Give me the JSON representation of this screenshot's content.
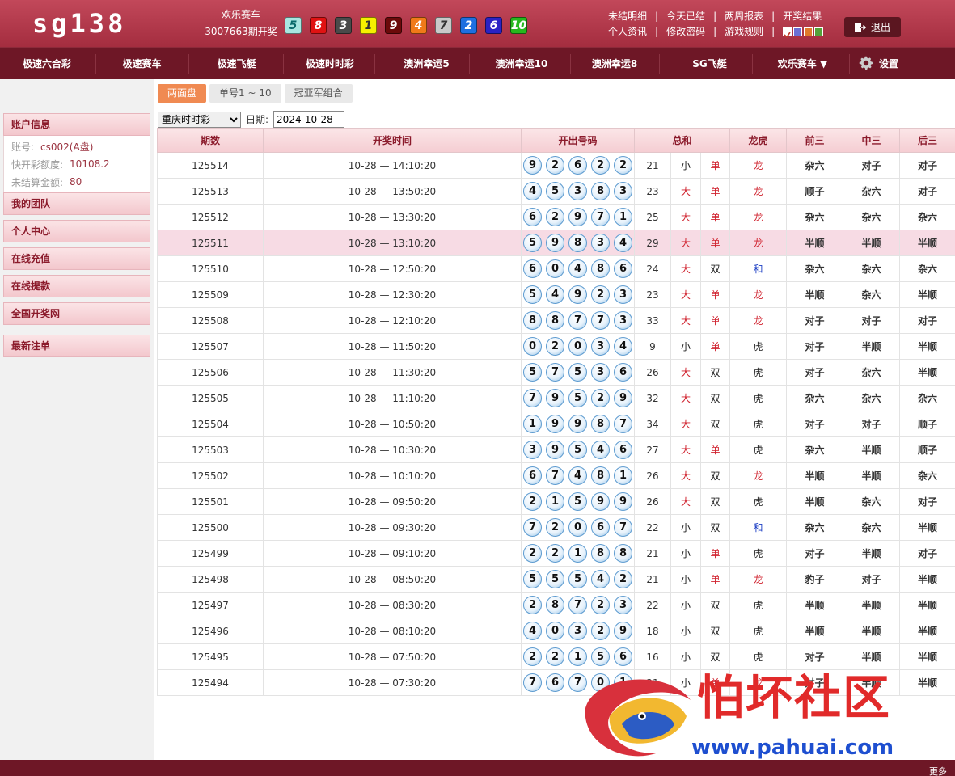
{
  "brand": {
    "logo": "sg138"
  },
  "draw_info": {
    "game": "欢乐赛车",
    "period": "3007663期开奖"
  },
  "header_balls": [
    {
      "n": "5",
      "color": "#a8e6e0",
      "fg": "#0a6b6b"
    },
    {
      "n": "8",
      "color": "#e01212",
      "fg": "#ffffff"
    },
    {
      "n": "3",
      "color": "#4a4a4a",
      "fg": "#ffffff"
    },
    {
      "n": "1",
      "color": "#f5f000",
      "fg": "#333333"
    },
    {
      "n": "9",
      "color": "#6b0a0a",
      "fg": "#ffffff"
    },
    {
      "n": "4",
      "color": "#f07a18",
      "fg": "#ffffff"
    },
    {
      "n": "7",
      "color": "#c9c9c9",
      "fg": "#333333"
    },
    {
      "n": "2",
      "color": "#1e6fe0",
      "fg": "#ffffff"
    },
    {
      "n": "6",
      "color": "#2a22c4",
      "fg": "#ffffff"
    },
    {
      "n": "10",
      "color": "#27b81d",
      "fg": "#ffffff"
    }
  ],
  "header_links": {
    "row1": [
      "未结明细",
      "今天已结",
      "两周报表",
      "开奖结果"
    ],
    "row2": [
      "个人资讯",
      "修改密码",
      "游戏规则"
    ],
    "theme_colors": [
      "#c0392b",
      "#6b6fd4",
      "#e07a2b",
      "#54a33a"
    ]
  },
  "logout": "退出",
  "nav": [
    "极速六合彩",
    "极速赛车",
    "极速飞艇",
    "极速时时彩",
    "澳洲幸运5",
    "澳洲幸运10",
    "澳洲幸运8",
    "SG飞艇",
    "欢乐赛车 ▼"
  ],
  "nav_settings": "设置",
  "sidebar": {
    "account_title": "账户信息",
    "account_label": "账号:",
    "account_value": "cs002(A盘)",
    "credit_label": "快开彩额度:",
    "credit_value": "10108.2",
    "unsettled_label": "未结算金额:",
    "unsettled_value": "80",
    "menu": [
      "我的团队",
      "个人中心",
      "在线充值",
      "在线提款",
      "全国开奖网",
      "最新注单"
    ]
  },
  "tabs": [
    "两面盘",
    "单号1 ~ 10",
    "冠亚军组合"
  ],
  "filter": {
    "lottery": "重庆时时彩",
    "date_label": "日期:",
    "date": "2024-10-28"
  },
  "columns": [
    "期数",
    "开奖时间",
    "开出号码",
    "总和",
    "龙虎",
    "前三",
    "中三",
    "后三"
  ],
  "rows": [
    {
      "id": "125514",
      "time": "10-28 — 14:10:20",
      "balls": [
        "9",
        "2",
        "6",
        "2",
        "2"
      ],
      "sum": "21",
      "size": "小",
      "odd": "单",
      "lh": "龙",
      "q": "杂六",
      "z": "对子",
      "h": "对子"
    },
    {
      "id": "125513",
      "time": "10-28 — 13:50:20",
      "balls": [
        "4",
        "5",
        "3",
        "8",
        "3"
      ],
      "sum": "23",
      "size": "大",
      "odd": "单",
      "lh": "龙",
      "q": "顺子",
      "z": "杂六",
      "h": "对子"
    },
    {
      "id": "125512",
      "time": "10-28 — 13:30:20",
      "balls": [
        "6",
        "2",
        "9",
        "7",
        "1"
      ],
      "sum": "25",
      "size": "大",
      "odd": "单",
      "lh": "龙",
      "q": "杂六",
      "z": "杂六",
      "h": "杂六"
    },
    {
      "id": "125511",
      "time": "10-28 — 13:10:20",
      "balls": [
        "5",
        "9",
        "8",
        "3",
        "4"
      ],
      "sum": "29",
      "size": "大",
      "odd": "单",
      "lh": "龙",
      "q": "半顺",
      "z": "半顺",
      "h": "半顺",
      "highlight": true
    },
    {
      "id": "125510",
      "time": "10-28 — 12:50:20",
      "balls": [
        "6",
        "0",
        "4",
        "8",
        "6"
      ],
      "sum": "24",
      "size": "大",
      "odd": "双",
      "lh": "和",
      "q": "杂六",
      "z": "杂六",
      "h": "杂六"
    },
    {
      "id": "125509",
      "time": "10-28 — 12:30:20",
      "balls": [
        "5",
        "4",
        "9",
        "2",
        "3"
      ],
      "sum": "23",
      "size": "大",
      "odd": "单",
      "lh": "龙",
      "q": "半顺",
      "z": "杂六",
      "h": "半顺"
    },
    {
      "id": "125508",
      "time": "10-28 — 12:10:20",
      "balls": [
        "8",
        "8",
        "7",
        "7",
        "3"
      ],
      "sum": "33",
      "size": "大",
      "odd": "单",
      "lh": "龙",
      "q": "对子",
      "z": "对子",
      "h": "对子"
    },
    {
      "id": "125507",
      "time": "10-28 — 11:50:20",
      "balls": [
        "0",
        "2",
        "0",
        "3",
        "4"
      ],
      "sum": "9",
      "size": "小",
      "odd": "单",
      "lh": "虎",
      "q": "对子",
      "z": "半顺",
      "h": "半顺"
    },
    {
      "id": "125506",
      "time": "10-28 — 11:30:20",
      "balls": [
        "5",
        "7",
        "5",
        "3",
        "6"
      ],
      "sum": "26",
      "size": "大",
      "odd": "双",
      "lh": "虎",
      "q": "对子",
      "z": "杂六",
      "h": "半顺"
    },
    {
      "id": "125505",
      "time": "10-28 — 11:10:20",
      "balls": [
        "7",
        "9",
        "5",
        "2",
        "9"
      ],
      "sum": "32",
      "size": "大",
      "odd": "双",
      "lh": "虎",
      "q": "杂六",
      "z": "杂六",
      "h": "杂六"
    },
    {
      "id": "125504",
      "time": "10-28 — 10:50:20",
      "balls": [
        "1",
        "9",
        "9",
        "8",
        "7"
      ],
      "sum": "34",
      "size": "大",
      "odd": "双",
      "lh": "虎",
      "q": "对子",
      "z": "对子",
      "h": "顺子"
    },
    {
      "id": "125503",
      "time": "10-28 — 10:30:20",
      "balls": [
        "3",
        "9",
        "5",
        "4",
        "6"
      ],
      "sum": "27",
      "size": "大",
      "odd": "单",
      "lh": "虎",
      "q": "杂六",
      "z": "半顺",
      "h": "顺子"
    },
    {
      "id": "125502",
      "time": "10-28 — 10:10:20",
      "balls": [
        "6",
        "7",
        "4",
        "8",
        "1"
      ],
      "sum": "26",
      "size": "大",
      "odd": "双",
      "lh": "龙",
      "q": "半顺",
      "z": "半顺",
      "h": "杂六"
    },
    {
      "id": "125501",
      "time": "10-28 — 09:50:20",
      "balls": [
        "2",
        "1",
        "5",
        "9",
        "9"
      ],
      "sum": "26",
      "size": "大",
      "odd": "双",
      "lh": "虎",
      "q": "半顺",
      "z": "杂六",
      "h": "对子"
    },
    {
      "id": "125500",
      "time": "10-28 — 09:30:20",
      "balls": [
        "7",
        "2",
        "0",
        "6",
        "7"
      ],
      "sum": "22",
      "size": "小",
      "odd": "双",
      "lh": "和",
      "q": "杂六",
      "z": "杂六",
      "h": "半顺"
    },
    {
      "id": "125499",
      "time": "10-28 — 09:10:20",
      "balls": [
        "2",
        "2",
        "1",
        "8",
        "8"
      ],
      "sum": "21",
      "size": "小",
      "odd": "单",
      "lh": "虎",
      "q": "对子",
      "z": "半顺",
      "h": "对子"
    },
    {
      "id": "125498",
      "time": "10-28 — 08:50:20",
      "balls": [
        "5",
        "5",
        "5",
        "4",
        "2"
      ],
      "sum": "21",
      "size": "小",
      "odd": "单",
      "lh": "龙",
      "q": "豹子",
      "z": "对子",
      "h": "半顺"
    },
    {
      "id": "125497",
      "time": "10-28 — 08:30:20",
      "balls": [
        "2",
        "8",
        "7",
        "2",
        "3"
      ],
      "sum": "22",
      "size": "小",
      "odd": "双",
      "lh": "虎",
      "q": "半顺",
      "z": "半顺",
      "h": "半顺"
    },
    {
      "id": "125496",
      "time": "10-28 — 08:10:20",
      "balls": [
        "4",
        "0",
        "3",
        "2",
        "9"
      ],
      "sum": "18",
      "size": "小",
      "odd": "双",
      "lh": "虎",
      "q": "半顺",
      "z": "半顺",
      "h": "半顺"
    },
    {
      "id": "125495",
      "time": "10-28 — 07:50:20",
      "balls": [
        "2",
        "2",
        "1",
        "5",
        "6"
      ],
      "sum": "16",
      "size": "小",
      "odd": "双",
      "lh": "虎",
      "q": "对子",
      "z": "半顺",
      "h": "半顺"
    },
    {
      "id": "125494",
      "time": "10-28 — 07:30:20",
      "balls": [
        "7",
        "6",
        "7",
        "0",
        "1"
      ],
      "sum": "21",
      "size": "小",
      "odd": "单",
      "lh": "龙",
      "q": "对子",
      "z": "半顺",
      "h": "半顺"
    }
  ],
  "watermark": {
    "text": "怕坏社区",
    "url": "www.pahuai.com"
  },
  "footer": {
    "more": "更多"
  }
}
